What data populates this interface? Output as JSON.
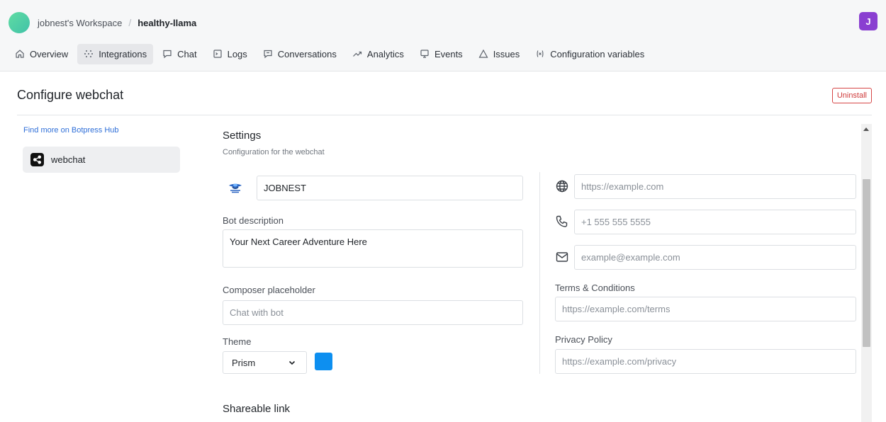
{
  "header": {
    "workspace": "jobnest's Workspace",
    "separator": "/",
    "bot": "healthy-llama",
    "user_initial": "J"
  },
  "nav": [
    {
      "label": "Overview",
      "icon": "home-icon",
      "active": false
    },
    {
      "label": "Integrations",
      "icon": "integrations-icon",
      "active": true
    },
    {
      "label": "Chat",
      "icon": "chat-icon",
      "active": false
    },
    {
      "label": "Logs",
      "icon": "logs-icon",
      "active": false
    },
    {
      "label": "Conversations",
      "icon": "conversations-icon",
      "active": false
    },
    {
      "label": "Analytics",
      "icon": "analytics-icon",
      "active": false
    },
    {
      "label": "Events",
      "icon": "events-icon",
      "active": false
    },
    {
      "label": "Issues",
      "icon": "issues-icon",
      "active": false
    },
    {
      "label": "Configuration variables",
      "icon": "variables-icon",
      "active": false
    }
  ],
  "page": {
    "title": "Configure webchat",
    "uninstall_label": "Uninstall"
  },
  "sidebar": {
    "hub_link": "Find more on Botpress Hub",
    "items": [
      {
        "label": "webchat",
        "icon": "share-icon"
      }
    ]
  },
  "settings": {
    "title": "Settings",
    "subtitle": "Configuration for the webchat",
    "bot_name": "JOBNEST",
    "bot_description_label": "Bot description",
    "bot_description_value": "Your Next Career Adventure Here",
    "composer_label": "Composer placeholder",
    "composer_placeholder": "Chat with bot",
    "theme_label": "Theme",
    "theme_value": "Prism",
    "theme_color": "#0d8ff0",
    "website_placeholder": "https://example.com",
    "phone_placeholder": "+1 555 555 5555",
    "email_placeholder": "example@example.com",
    "terms_label": "Terms & Conditions",
    "terms_placeholder": "https://example.com/terms",
    "privacy_label": "Privacy Policy",
    "privacy_placeholder": "https://example.com/privacy",
    "shareable_title": "Shareable link"
  },
  "colors": {
    "accent_user": "#8a3fd1",
    "danger": "#cf3a3a",
    "link": "#2f6fd8"
  }
}
